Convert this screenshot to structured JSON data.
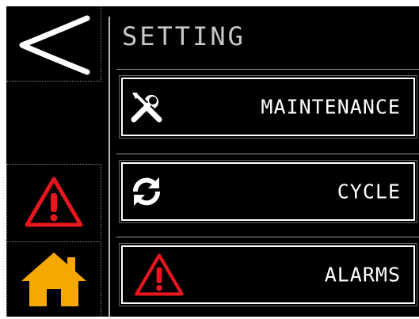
{
  "header": {
    "title": "SETTING"
  },
  "sidebar": {
    "back": {
      "icon": "back-arrow-icon"
    },
    "alarm": {
      "icon": "warning-icon",
      "color": "#e8161e"
    },
    "home": {
      "icon": "home-icon",
      "color": "#f7a800"
    }
  },
  "menu": {
    "items": [
      {
        "label": "MAINTENANCE",
        "icon": "wrench-screwdriver-icon"
      },
      {
        "label": "CYCLE",
        "icon": "refresh-icon"
      },
      {
        "label": "ALARMS",
        "icon": "warning-icon"
      }
    ]
  }
}
